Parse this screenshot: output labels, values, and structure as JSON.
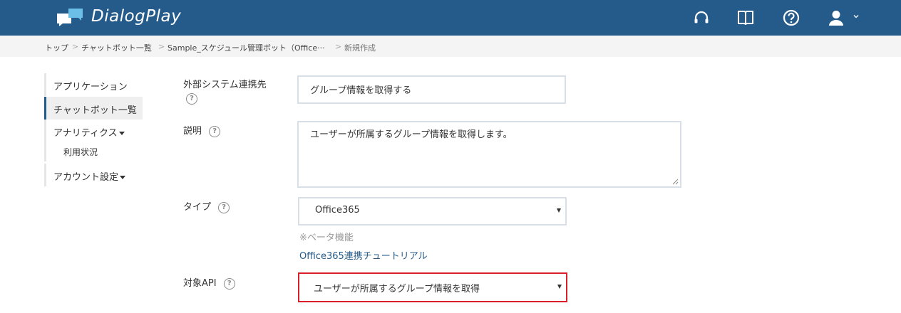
{
  "header": {
    "app_name": "DialogPlay",
    "icons": [
      "headset-icon",
      "book-icon",
      "help-icon",
      "user-icon"
    ],
    "brand_color": "#245b8a"
  },
  "breadcrumb": {
    "items": [
      "トップ",
      "チャットボット一覧",
      "Sample_スケジュール管理ボット（Office···",
      "新規作成"
    ],
    "separator": ">"
  },
  "sidebar": {
    "items": [
      {
        "label": "アプリケーション"
      },
      {
        "label": "チャットボット一覧",
        "active": true
      },
      {
        "label": "アナリティクス"
      },
      {
        "label": "利用状況"
      },
      {
        "label": "アカウント設定"
      }
    ]
  },
  "form": {
    "external_system": {
      "label": "外部システム連携先",
      "value": "グループ情報を取得する"
    },
    "description": {
      "label": "説明",
      "value": "ユーザーが所属するグループ情報を取得します。"
    },
    "type": {
      "label": "タイプ",
      "value": "Office365",
      "beta_note": "※ベータ機能",
      "tutorial_link": "Office365連携チュートリアル"
    },
    "target_api": {
      "label": "対象API",
      "value": "ユーザーが所属するグループ情報を取得"
    },
    "help_glyph": "?",
    "highlight_color": "#d9202a"
  }
}
